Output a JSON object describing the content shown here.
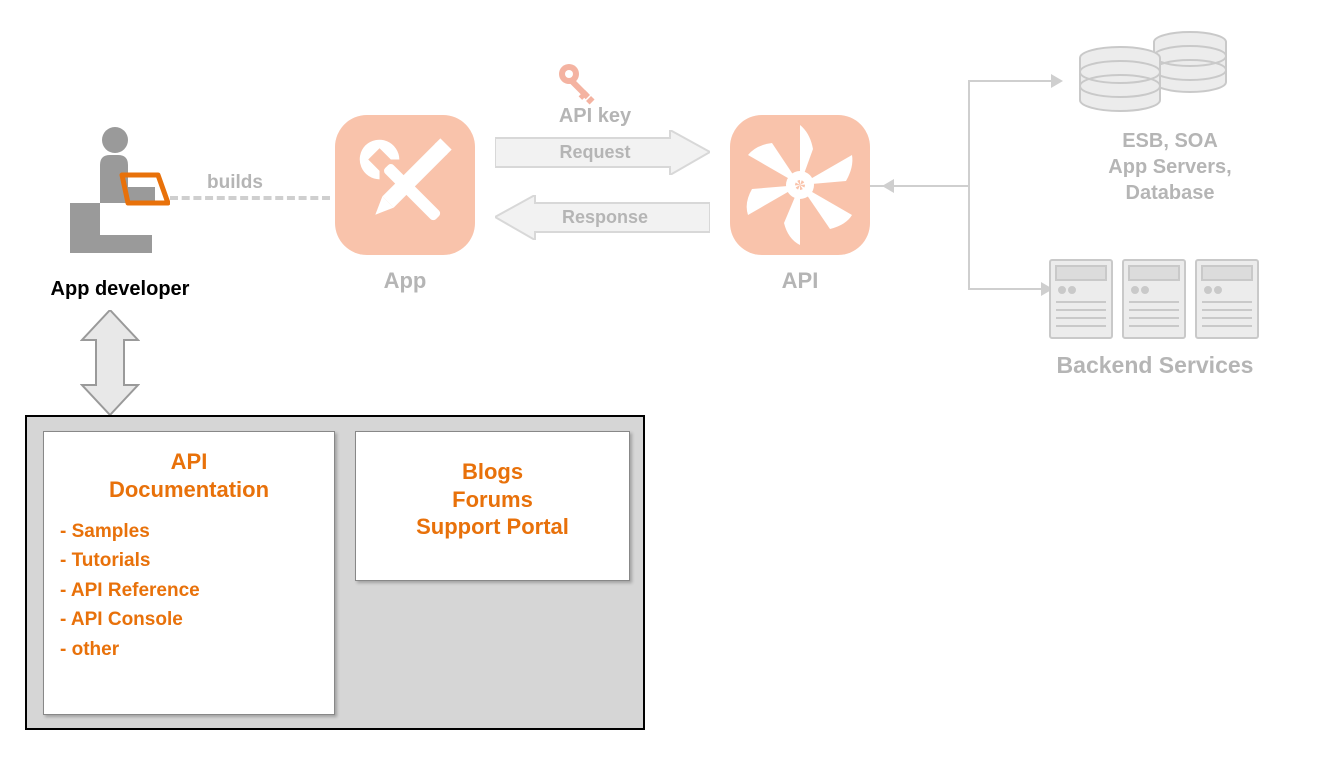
{
  "developer": {
    "label": "App developer"
  },
  "builds": {
    "label": "builds"
  },
  "app": {
    "label": "App"
  },
  "api": {
    "label": "API"
  },
  "api_key": {
    "label": "API key"
  },
  "request": {
    "label": "Request"
  },
  "response": {
    "label": "Response"
  },
  "backend": {
    "top_lines": [
      "ESB, SOA",
      "App Servers,",
      "Database"
    ],
    "bottom_label": "Backend Services"
  },
  "portal": {
    "card1": {
      "title_line1": "API",
      "title_line2": "Documentation",
      "items": [
        "- Samples",
        "- Tutorials",
        "- API Reference",
        "- API Console",
        "- other"
      ]
    },
    "card2": {
      "lines": [
        "Blogs",
        "Forums",
        "Support Portal"
      ]
    }
  },
  "colors": {
    "accent": "#e8710a",
    "faded": "#b5b5b5",
    "appBg": "#f9c3ab",
    "keyRed": "#f4a08e"
  }
}
